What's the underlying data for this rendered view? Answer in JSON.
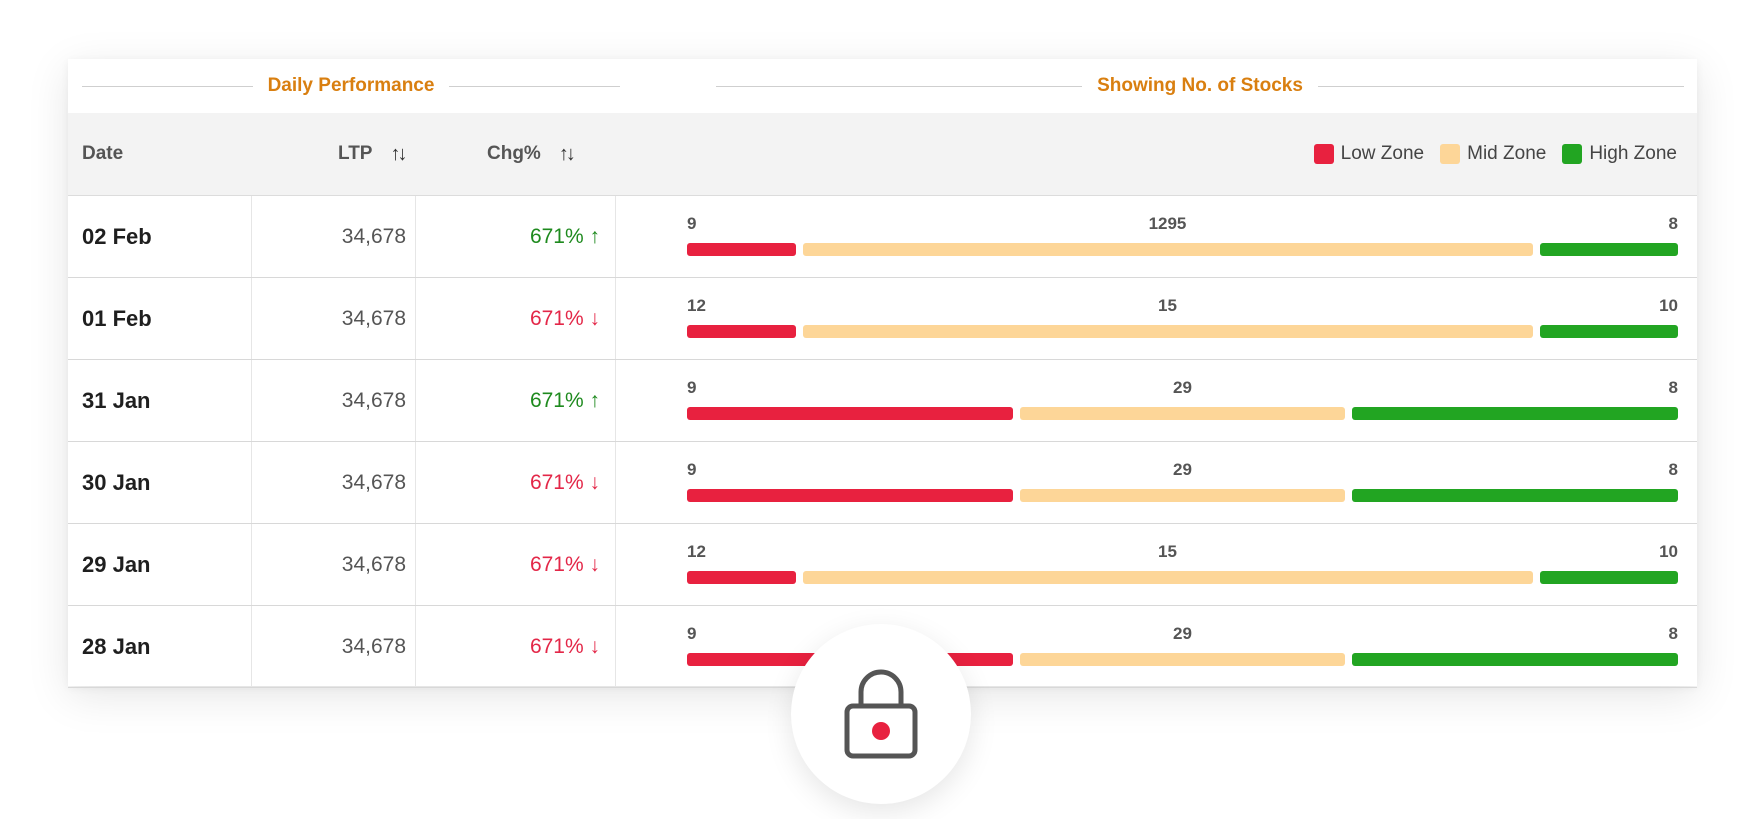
{
  "section_titles": {
    "left": "Daily Performance",
    "right": "Showing No. of Stocks"
  },
  "headers": {
    "date": "Date",
    "ltp": "LTP",
    "chg": "Chg%",
    "sort_glyph": "↑↓"
  },
  "legend": [
    {
      "label": "Low Zone",
      "color": "#e8213f"
    },
    {
      "label": "Mid Zone",
      "color": "#fdd698"
    },
    {
      "label": "High Zone",
      "color": "#22a522"
    }
  ],
  "rows": [
    {
      "date": "02 Feb",
      "ltp": "34,678",
      "chg": "671% ↑",
      "dir": "up",
      "low": "9",
      "mid": "1295",
      "high": "8",
      "fractions": [
        0.11,
        0.74,
        0.14
      ]
    },
    {
      "date": "01 Feb",
      "ltp": "34,678",
      "chg": "671% ↓",
      "dir": "down",
      "low": "12",
      "mid": "15",
      "high": "10",
      "fractions": [
        0.11,
        0.74,
        0.14
      ]
    },
    {
      "date": "31 Jan",
      "ltp": "34,678",
      "chg": "671% ↑",
      "dir": "up",
      "low": "9",
      "mid": "29",
      "high": "8",
      "fractions": [
        0.33,
        0.33,
        0.33
      ]
    },
    {
      "date": "30 Jan",
      "ltp": "34,678",
      "chg": "671% ↓",
      "dir": "down",
      "low": "9",
      "mid": "29",
      "high": "8",
      "fractions": [
        0.33,
        0.33,
        0.33
      ]
    },
    {
      "date": "29 Jan",
      "ltp": "34,678",
      "chg": "671% ↓",
      "dir": "down",
      "low": "12",
      "mid": "15",
      "high": "10",
      "fractions": [
        0.11,
        0.74,
        0.14
      ]
    },
    {
      "date": "28 Jan",
      "ltp": "34,678",
      "chg": "671% ↓",
      "dir": "down",
      "low": "9",
      "mid": "29",
      "high": "8",
      "fractions": [
        0.33,
        0.33,
        0.33
      ]
    }
  ],
  "colors": {
    "accent": "#d97f10",
    "up": "#1e8a1e",
    "down": "#e32748",
    "low_zone": "#e8213f",
    "mid_zone": "#fdd698",
    "high_zone": "#22a522",
    "lock_dot": "#e8213f"
  },
  "lock_icon": "padlock-icon"
}
